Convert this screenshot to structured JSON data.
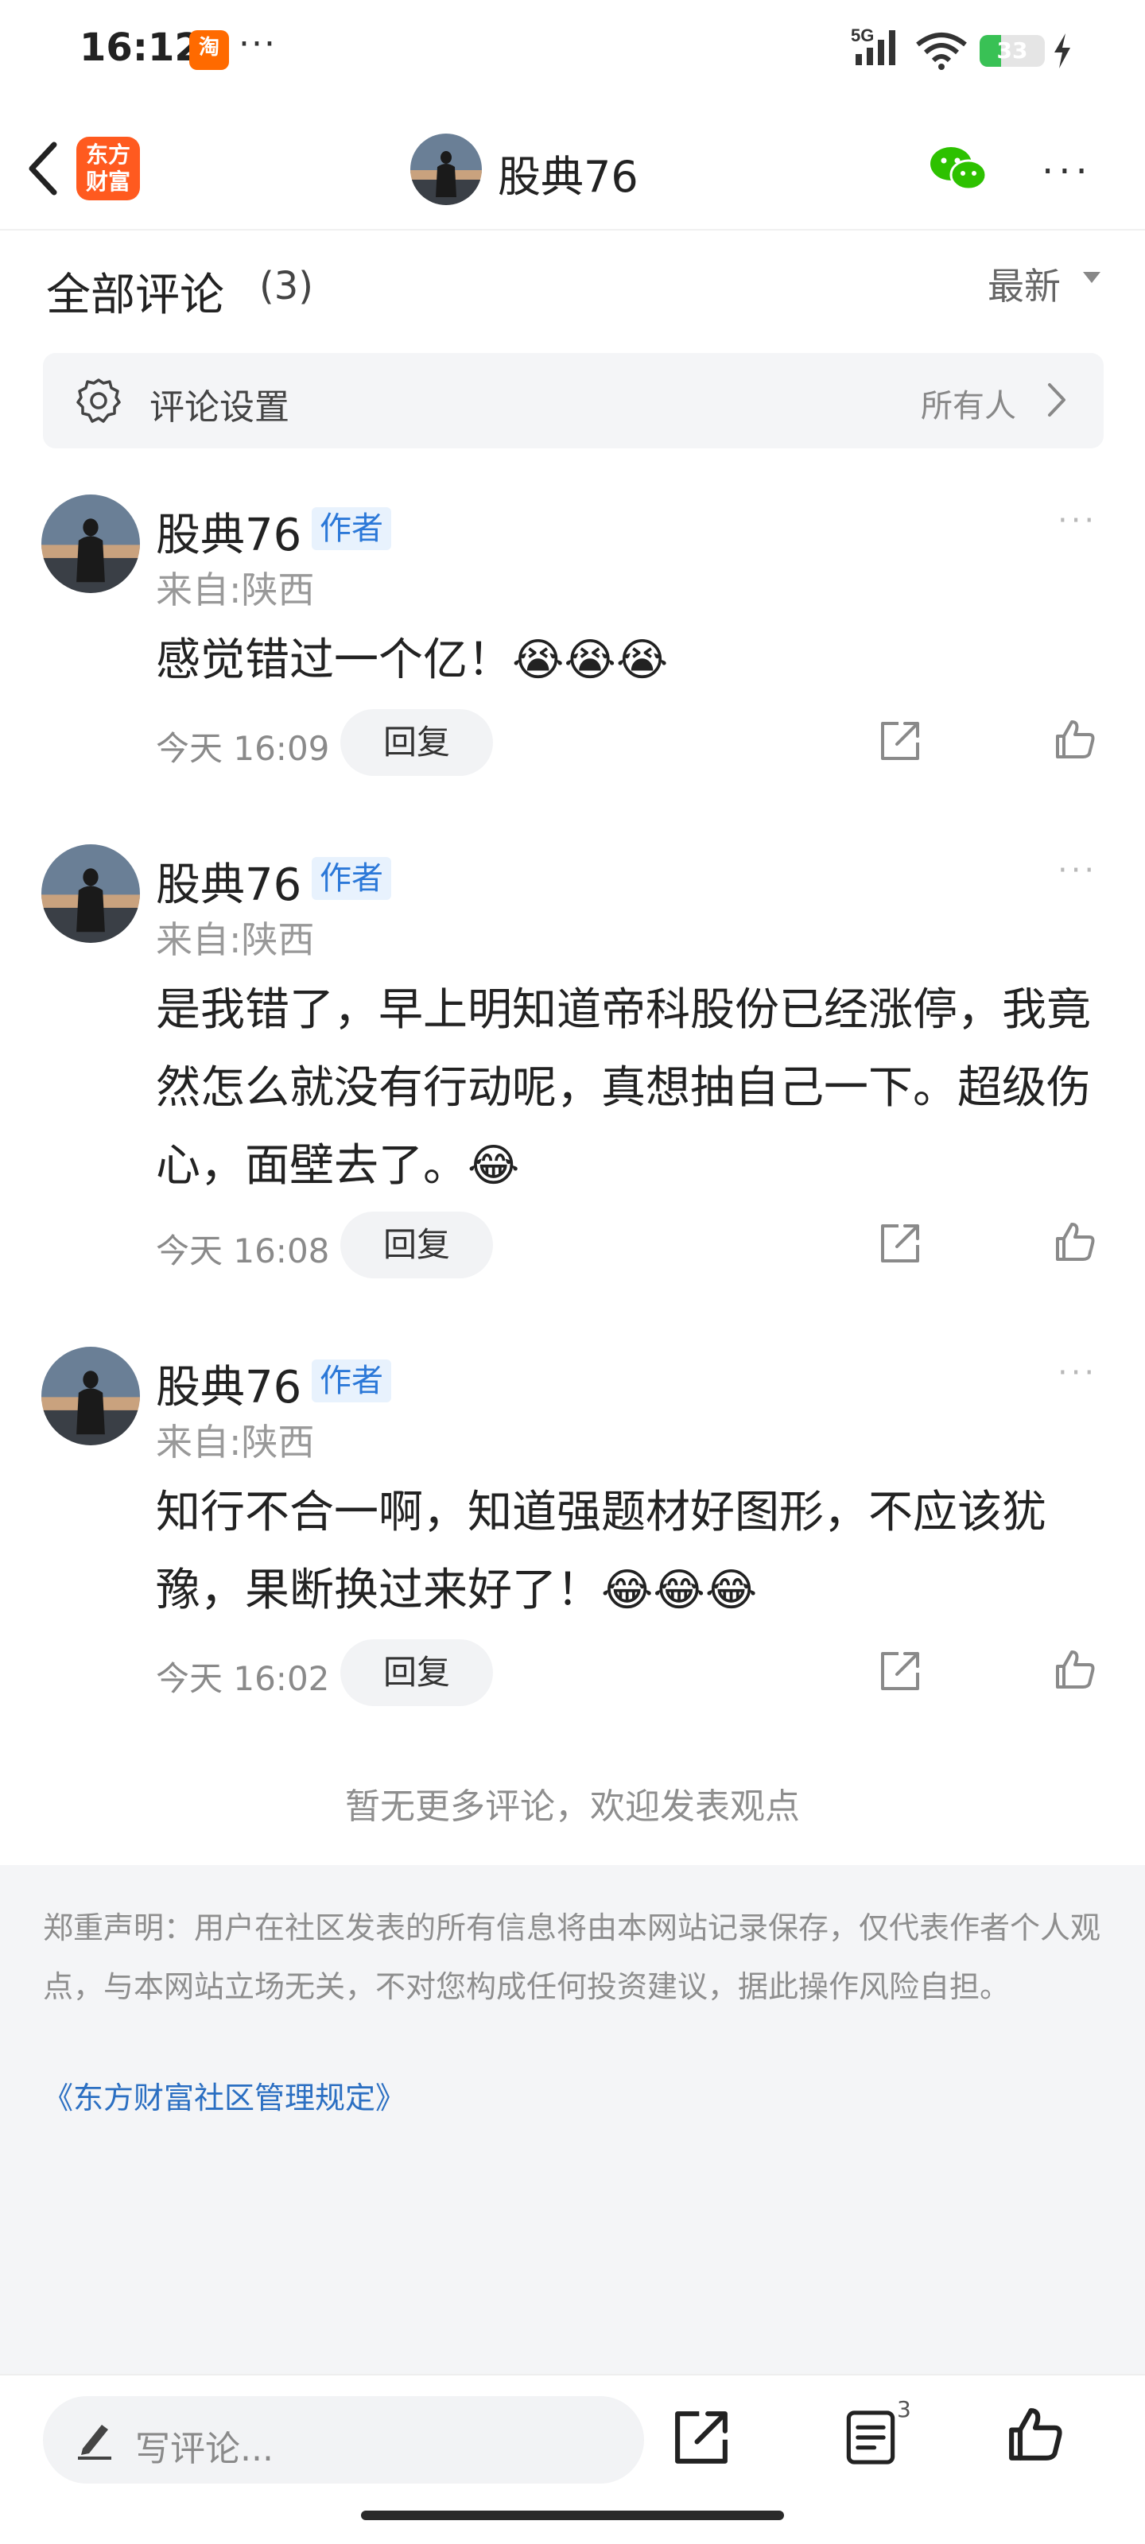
{
  "status_bar": {
    "time": "16:12",
    "taobao_icon": "淘",
    "more": "···",
    "network": "5G",
    "battery": "33",
    "battery_level": 0.33
  },
  "nav": {
    "logo_text": "东方财富",
    "title": "股典76"
  },
  "comments_header": {
    "title": "全部评论",
    "count": "(3)",
    "sort_label": "最新"
  },
  "settings": {
    "label": "评论设置",
    "value": "所有人"
  },
  "comments": [
    {
      "author": "股典76",
      "badge": "作者",
      "location": "来自:陕西",
      "text": "感觉错过一个亿！😭😭😭",
      "time": "今天 16:09",
      "reply_label": "回复"
    },
    {
      "author": "股典76",
      "badge": "作者",
      "location": "来自:陕西",
      "text": "是我错了，早上明知道帝科股份已经涨停，我竟然怎么就没有行动呢，真想抽自己一下。超级伤心，面壁去了。😂",
      "time": "今天 16:08",
      "reply_label": "回复"
    },
    {
      "author": "股典76",
      "badge": "作者",
      "location": "来自:陕西",
      "text": "知行不合一啊，知道强题材好图形，不应该犹豫，果断换过来好了！😂😂😂",
      "time": "今天 16:02",
      "reply_label": "回复"
    }
  ],
  "no_more_text": "暂无更多评论，欢迎发表观点",
  "disclaimer": {
    "text": "郑重声明：用户在社区发表的所有信息将由本网站记录保存，仅代表作者个人观点，与本网站立场无关，不对您构成任何投资建议，据此操作风险自担。",
    "link": "《东方财富社区管理规定》"
  },
  "bottom_bar": {
    "input_placeholder": "写评论...",
    "comment_count": "3"
  },
  "colors": {
    "brand_orange": "#ff5a1f",
    "badge_blue": "#2b78d8",
    "link_blue": "#2b6fc2",
    "battery_green": "#39c155",
    "wechat_green": "#2dc100"
  }
}
